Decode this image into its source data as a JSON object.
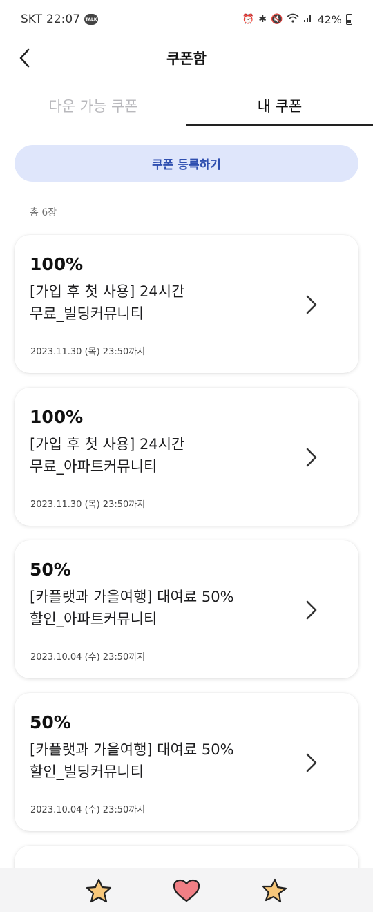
{
  "status_bar": {
    "carrier": "SKT",
    "time": "22:07",
    "talk_badge": "TALK",
    "battery": "42%"
  },
  "header": {
    "title": "쿠폰함",
    "back_icon": "chevron-left-icon"
  },
  "tabs": [
    {
      "label": "다운 가능 쿠폰",
      "active": false
    },
    {
      "label": "내 쿠폰",
      "active": true
    }
  ],
  "register_button": {
    "label": "쿠폰 등록하기"
  },
  "total": {
    "label": "총 6장"
  },
  "coupons": [
    {
      "discount": "100%",
      "name": "[가입 후 첫 사용] 24시간\n무료_빌딩커뮤니티",
      "expiry": "2023.11.30 (목) 23:50까지"
    },
    {
      "discount": "100%",
      "name": "[가입 후 첫 사용] 24시간\n무료_아파트커뮤니티",
      "expiry": "2023.11.30 (목) 23:50까지"
    },
    {
      "discount": "50%",
      "name": "[카플랫과 가을여행] 대여료 50%\n할인_아파트커뮤니티",
      "expiry": "2023.10.04 (수) 23:50까지"
    },
    {
      "discount": "50%",
      "name": "[카플랫과 가을여행] 대여료 50%\n할인_빌딩커뮤니티",
      "expiry": "2023.10.04 (수) 23:50까지"
    }
  ],
  "bottom_nav": [
    {
      "icon": "star-icon",
      "color": "#f7c77a"
    },
    {
      "icon": "heart-icon",
      "color": "#f07f85"
    },
    {
      "icon": "star-icon",
      "color": "#f7c77a"
    }
  ],
  "colors": {
    "accent_bg": "#dfe6fb",
    "accent_text": "#2f4fb0",
    "inactive_tab": "#b8b8bc"
  }
}
